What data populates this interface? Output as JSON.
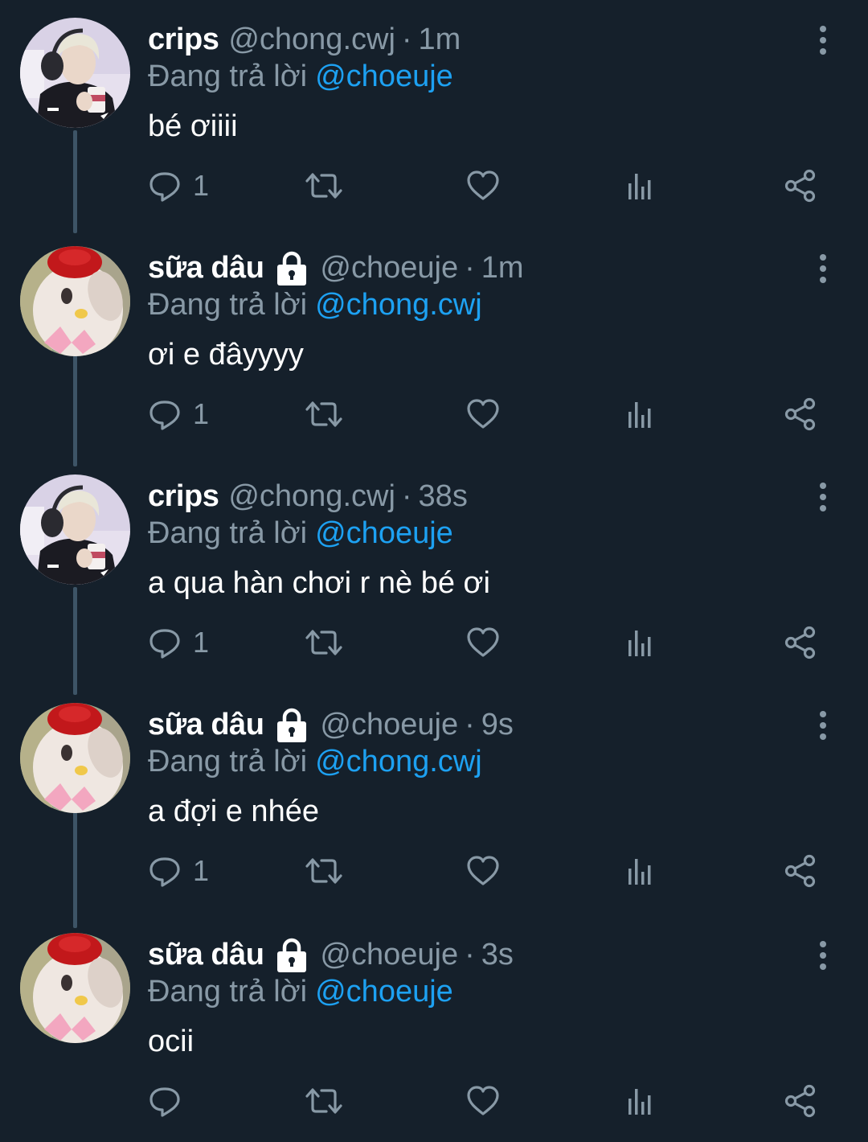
{
  "reply_prefix": "Đang trả lời",
  "dot": "·",
  "tweets": [
    {
      "name": "crips",
      "handle": "@chong.cwj",
      "time": "1m",
      "reply_to": "@choeuje",
      "text": "bé ơiiii",
      "reply_count": "1",
      "avatar": "crips-avatar",
      "locked": false
    },
    {
      "name": "sữa dâu",
      "handle": "@choeuje",
      "time": "1m",
      "reply_to": "@chong.cwj",
      "text": "ơi e đâyyyy",
      "reply_count": "1",
      "avatar": "sua-dau-avatar",
      "locked": true
    },
    {
      "name": "crips",
      "handle": "@chong.cwj",
      "time": "38s",
      "reply_to": "@choeuje",
      "text": "a qua hàn chơi r nè bé ơi",
      "reply_count": "1",
      "avatar": "crips-avatar",
      "locked": false
    },
    {
      "name": "sữa dâu",
      "handle": "@choeuje",
      "time": "9s",
      "reply_to": "@chong.cwj",
      "text": "a đợi e nhée",
      "reply_count": "1",
      "avatar": "sua-dau-avatar",
      "locked": true
    },
    {
      "name": "sữa dâu",
      "handle": "@choeuje",
      "time": "3s",
      "reply_to": "@choeuje",
      "text": "ocii",
      "reply_count": "",
      "avatar": "sua-dau-avatar",
      "locked": true
    }
  ],
  "colors": {
    "background": "#15202b",
    "secondary_text": "#8899a6",
    "mention": "#1da1f2",
    "thread_line": "#3d5466"
  },
  "icons": [
    "reply-icon",
    "retweet-icon",
    "like-icon",
    "analytics-icon",
    "share-icon",
    "more-options-icon",
    "lock-icon"
  ]
}
